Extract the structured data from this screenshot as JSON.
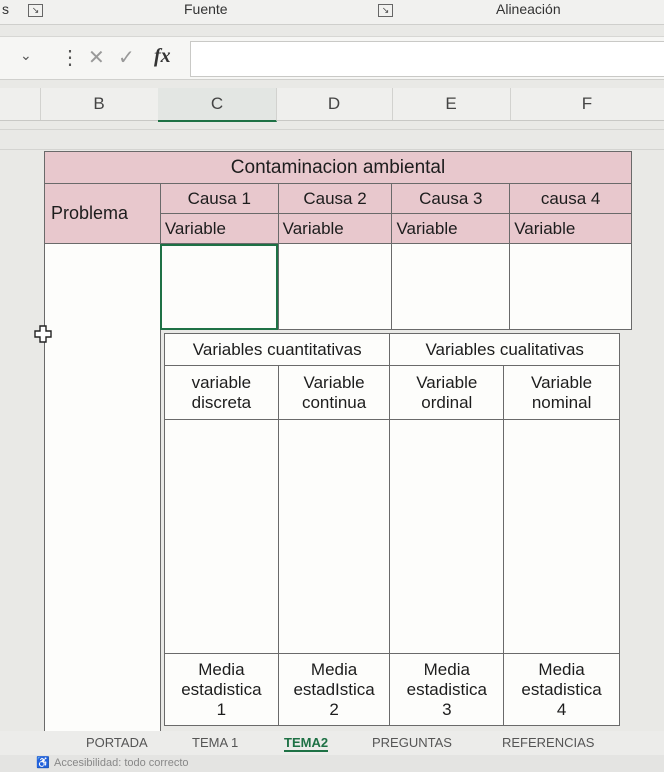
{
  "ribbon": {
    "left_fragment": "s",
    "groups": [
      {
        "label": "Fuente"
      },
      {
        "label": "Alineación"
      }
    ],
    "launcher_icon": "dialog-launcher-icon"
  },
  "formula_bar": {
    "namebox_icon": "chevron-down-icon",
    "dots": "⋮",
    "cancel": "✕",
    "enter": "✓",
    "fx": "fx",
    "value": ""
  },
  "columns": [
    "B",
    "C",
    "D",
    "E",
    "F"
  ],
  "table1": {
    "title": "Contaminacion ambiental",
    "problem_label": "Problema",
    "causes": [
      "Causa 1",
      "Causa 2",
      "Causa 3",
      "causa 4"
    ],
    "variable_row": [
      "Variable",
      "Variable",
      "Variable",
      "Variable"
    ]
  },
  "table2": {
    "group_headers": [
      "Variables cuantitativas",
      "Variables cualitativas"
    ],
    "sub_headers": [
      [
        "variable",
        "discreta"
      ],
      [
        "Variable",
        "continua"
      ],
      [
        "Variable",
        "ordinal"
      ],
      [
        "Variable",
        "nominal"
      ]
    ],
    "footer": [
      [
        "Media",
        "estadistica",
        "1"
      ],
      [
        "Media",
        "estadIstica",
        "2"
      ],
      [
        "Media",
        "estadistica",
        "3"
      ],
      [
        "Media",
        "estadistica",
        "4"
      ]
    ]
  },
  "sheet_tabs": [
    "PORTADA",
    "TEMA 1",
    "TEMA2",
    "PREGUNTAS",
    "REFERENCIAS"
  ],
  "active_tab": "TEMA2",
  "status_text": "Accesibilidad: todo correcto",
  "colors": {
    "header_pink": "#e8c8cd",
    "excel_green": "#1e7145"
  }
}
